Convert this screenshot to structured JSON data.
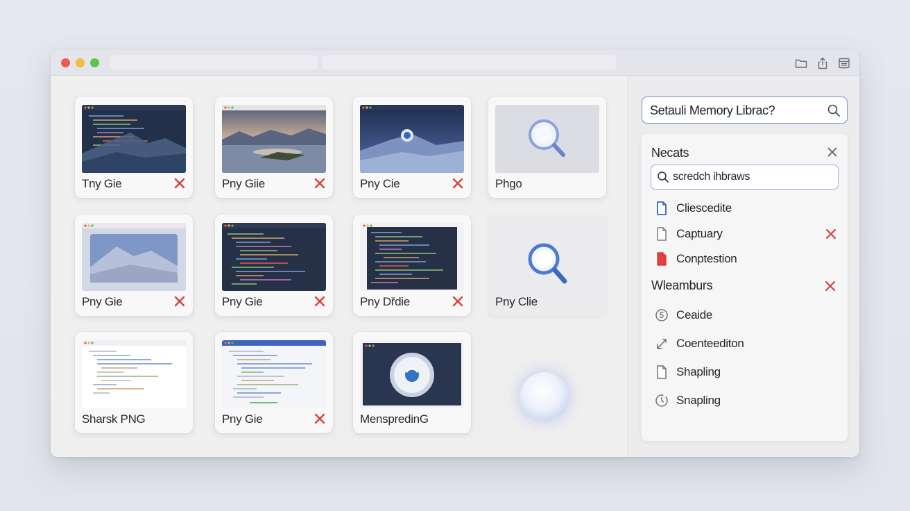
{
  "window": {
    "controls": [
      "close",
      "minimize",
      "zoom"
    ],
    "toolbar_icons": [
      "folder-icon",
      "share-icon",
      "archive-icon"
    ]
  },
  "cards": [
    {
      "label": "Tny Gie",
      "thumb": "code-mountain",
      "removable": true
    },
    {
      "label": "Pny Giie",
      "thumb": "lake",
      "removable": true
    },
    {
      "label": "Pny Cie",
      "thumb": "mountain-globe",
      "removable": true
    },
    {
      "label": "Phgo",
      "thumb": "magnifier",
      "removable": false
    },
    {
      "label": "Pny Gie",
      "thumb": "desert",
      "removable": true
    },
    {
      "label": "Pny Gie",
      "thumb": "code-dark",
      "removable": true
    },
    {
      "label": "Pny Dřdie",
      "thumb": "code-dark-2",
      "removable": true
    },
    {
      "label": "Pny Clie",
      "thumb": "magnifier-large",
      "removable": false
    },
    {
      "label": "Sharsk PNG",
      "thumb": "code-light",
      "removable": false
    },
    {
      "label": "Pny Gie",
      "thumb": "code-light-2",
      "removable": true
    },
    {
      "label": "MenspredinG",
      "thumb": "globe-window",
      "removable": false
    }
  ],
  "sidebar": {
    "search_value": "Setauli Memory Librac?",
    "panel": {
      "title": "Necats",
      "search_value": "scredch ihbraws",
      "items": [
        {
          "label": "Cliescedite",
          "icon": "document-blue-icon",
          "removable": false
        },
        {
          "label": "Captuary",
          "icon": "document-icon",
          "removable": true
        },
        {
          "label": "Conptestion",
          "icon": "document-red-icon",
          "removable": false
        }
      ],
      "section_title": "Wleamburs",
      "section_items": [
        {
          "label": "Ceaide",
          "icon": "circle-badge-icon"
        },
        {
          "label": "Coenteediton",
          "icon": "expand-arrow-icon"
        },
        {
          "label": "Shapling",
          "icon": "document-icon"
        },
        {
          "label": "Snapling",
          "icon": "clock-badge-icon"
        }
      ]
    }
  },
  "colors": {
    "accent_blue": "#6f8fd0",
    "remove_red": "#d8413a",
    "window_bg": "#efefef"
  }
}
